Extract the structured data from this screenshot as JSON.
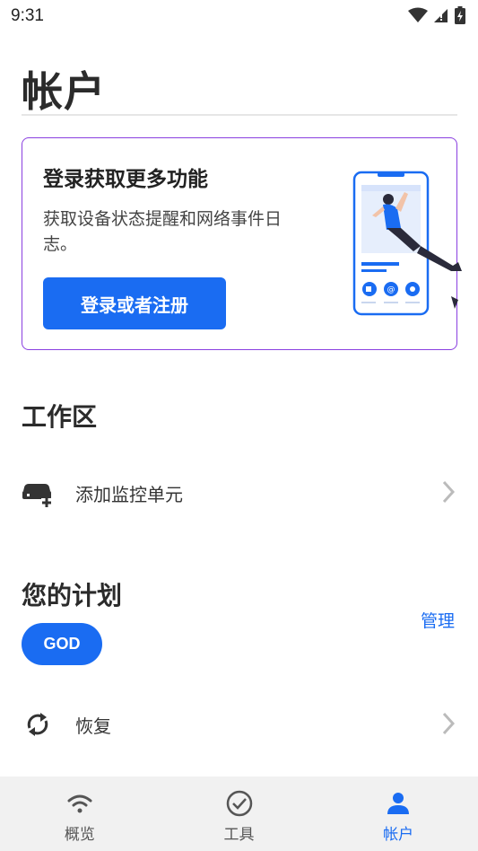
{
  "status_bar": {
    "time": "9:31"
  },
  "page": {
    "title": "帐户"
  },
  "login_card": {
    "title": "登录获取更多功能",
    "description": "获取设备状态提醒和网络事件日志。",
    "button_label": "登录或者注册",
    "accent_color": "#1a6cf2",
    "border_color": "#8a3fe0"
  },
  "workspace": {
    "heading": "工作区",
    "items": [
      {
        "label": "添加监控单元",
        "icon": "router-add-icon"
      }
    ]
  },
  "plan": {
    "heading": "您的计划",
    "manage_label": "管理",
    "badge": "GOD",
    "items": [
      {
        "label": "恢复",
        "icon": "sync-icon"
      }
    ]
  },
  "bottom_nav": {
    "items": [
      {
        "label": "概览",
        "icon": "wifi-icon",
        "active": false
      },
      {
        "label": "工具",
        "icon": "check-circle-icon",
        "active": false
      },
      {
        "label": "帐户",
        "icon": "person-icon",
        "active": true
      }
    ]
  }
}
